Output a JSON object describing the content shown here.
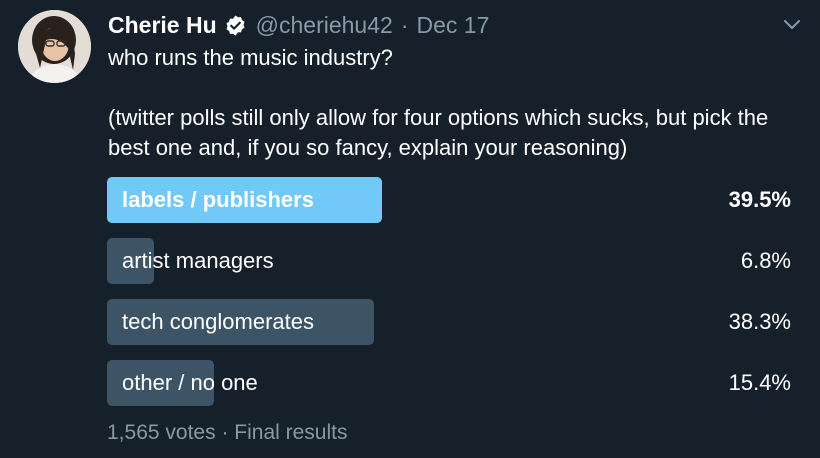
{
  "author": {
    "name": "Cherie Hu",
    "handle": "@cheriehu42",
    "separator": "·",
    "date": "Dec 17"
  },
  "tweet": {
    "text": "who runs the music industry?\n\n(twitter polls still only allow for four options which sucks, but pick the best one and, if you so fancy, explain your reasoning)"
  },
  "poll": {
    "options": [
      {
        "label": "labels / publishers",
        "percent_text": "39.5%",
        "percent": 39.5,
        "winner": true
      },
      {
        "label": "artist managers",
        "percent_text": "6.8%",
        "percent": 6.8,
        "winner": false
      },
      {
        "label": "tech conglomerates",
        "percent_text": "38.3%",
        "percent": 38.3,
        "winner": false
      },
      {
        "label": "other / no one",
        "percent_text": "15.4%",
        "percent": 15.4,
        "winner": false
      }
    ],
    "votes": "1,565 votes",
    "footer_separator": "·",
    "status": "Final results"
  },
  "colors": {
    "background": "#15202b",
    "winner_bar": "#71c9f8",
    "bar": "#3d5466",
    "muted_text": "#8899a6",
    "verified_badge": "#ffffff"
  },
  "icons": {
    "verified": "verified-badge-icon",
    "menu": "chevron-down-icon"
  }
}
